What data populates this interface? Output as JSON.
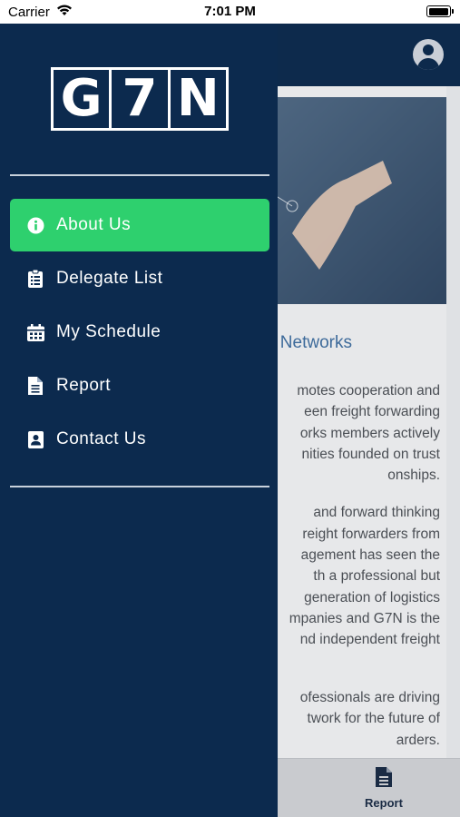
{
  "status_bar": {
    "carrier": "Carrier",
    "time": "7:01 PM"
  },
  "logo": {
    "letters": [
      "G",
      "7",
      "N"
    ]
  },
  "menu": {
    "items": [
      {
        "label": "About Us",
        "icon": "info-icon",
        "active": true
      },
      {
        "label": "Delegate List",
        "icon": "clipboard-list-icon",
        "active": false
      },
      {
        "label": "My Schedule",
        "icon": "calendar-icon",
        "active": false
      },
      {
        "label": "Report",
        "icon": "document-icon",
        "active": false
      },
      {
        "label": "Contact Us",
        "icon": "contact-card-icon",
        "active": false
      }
    ]
  },
  "background": {
    "title_fragment": "ts Networks",
    "paragraph1": [
      "motes cooperation and",
      "een freight forwarding",
      "orks members actively",
      "nities founded on trust",
      "onships."
    ],
    "paragraph2": [
      "and forward thinking",
      "reight forwarders from",
      "agement has seen the",
      "th a professional but",
      "generation of logistics",
      "mpanies and G7N is the",
      "nd independent freight"
    ],
    "paragraph3": [
      "ofessionals are driving",
      "twork for the future of",
      "arders."
    ],
    "bottom_tab": {
      "label": "Report",
      "icon": "document-icon"
    }
  },
  "colors": {
    "drawer": "#0c2a4e",
    "active": "#2ed06e",
    "header": "#0d2a4c",
    "title": "#3d6a9a"
  }
}
